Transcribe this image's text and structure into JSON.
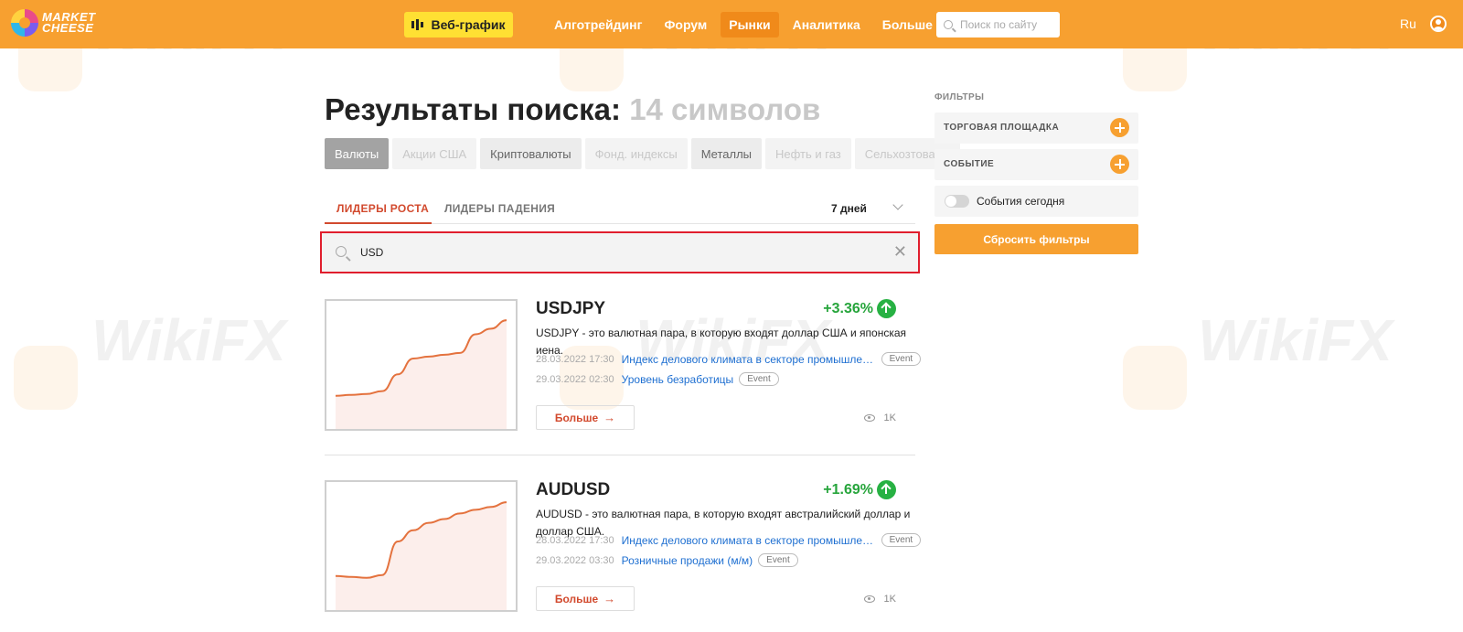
{
  "header": {
    "logo_line1": "MARKET",
    "logo_line2": "CHEESE",
    "webchart_label": "Веб-график",
    "nav": [
      "Алготрейдинг",
      "Форум",
      "Рынки",
      "Аналитика",
      "Больше"
    ],
    "nav_active": "Рынки",
    "search_placeholder": "Поиск по сайту",
    "lang": "Ru",
    "accent_color": "#f7a030"
  },
  "title": {
    "main": "Результаты поиска:",
    "count": "14 символов"
  },
  "categories": [
    {
      "label": "Валюты",
      "state": "active"
    },
    {
      "label": "Акции США",
      "state": "disabled"
    },
    {
      "label": "Криптовалюты",
      "state": "available"
    },
    {
      "label": "Фонд. индексы",
      "state": "disabled"
    },
    {
      "label": "Металлы",
      "state": "available"
    },
    {
      "label": "Нефть и газ",
      "state": "disabled"
    },
    {
      "label": "Сельхозтовары",
      "state": "disabled"
    }
  ],
  "tabs": {
    "growth": "ЛИДЕРЫ РОСТА",
    "decline": "ЛИДЕРЫ ПАДЕНИЯ",
    "period": "7 дней"
  },
  "search": {
    "value": "USD",
    "clear_icon": "close-icon"
  },
  "results": [
    {
      "symbol": "USDJPY",
      "change": "+3.36%",
      "description": "USDJPY - это валютная пара, в которую входят доллар США и японская иена.",
      "events": [
        {
          "time": "28.03.2022 17:30",
          "name": "Индекс делового климата в секторе промышленности",
          "tag": "Event"
        },
        {
          "time": "29.03.2022 02:30",
          "name": "Уровень безработицы",
          "tag": "Event"
        }
      ],
      "more_label": "Больше",
      "views": "1K",
      "sparkline": [
        0.12,
        0.13,
        0.14,
        0.17,
        0.35,
        0.52,
        0.54,
        0.56,
        0.58,
        0.78,
        0.84,
        0.93
      ]
    },
    {
      "symbol": "AUDUSD",
      "change": "+1.69%",
      "description": "AUDUSD - это валютная пара, в которую входят австралийский доллар и доллар США.",
      "events": [
        {
          "time": "28.03.2022 17:30",
          "name": "Индекс делового климата в секторе промышленности",
          "tag": "Event"
        },
        {
          "time": "29.03.2022 03:30",
          "name": "Розничные продажи (м/м)",
          "tag": "Event"
        }
      ],
      "more_label": "Больше",
      "views": "1K",
      "sparkline": [
        0.13,
        0.12,
        0.11,
        0.14,
        0.5,
        0.62,
        0.7,
        0.74,
        0.8,
        0.84,
        0.87,
        0.92
      ]
    }
  ],
  "filters": {
    "title": "ФИЛЬТРЫ",
    "platform": "ТОРГОВАЯ ПЛОЩАДКА",
    "event": "СОБЫТИЕ",
    "today": "События сегодня",
    "reset": "Сбросить фильтры"
  },
  "watermark": "WikiFX"
}
